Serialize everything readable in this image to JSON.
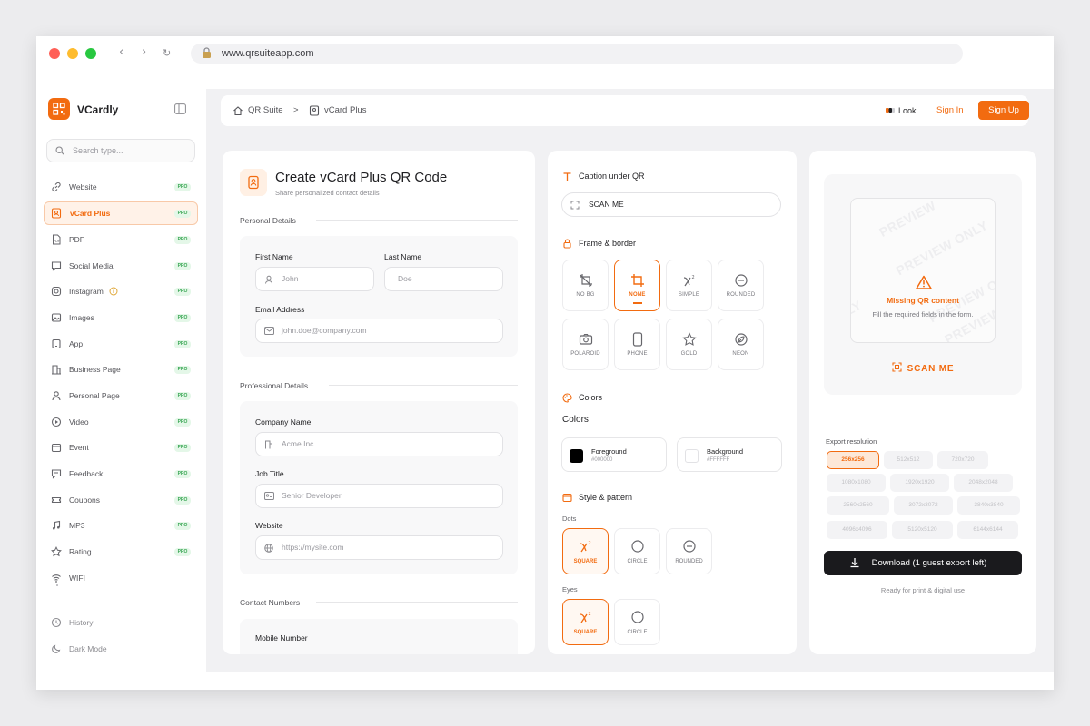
{
  "browser": {
    "url": "www.qrsuiteapp.com",
    "back": "‹",
    "forward": "›",
    "reload": "↻"
  },
  "sidebar": {
    "brand": "VCardly",
    "search_placeholder": "Search type...",
    "items": [
      {
        "label": "Website",
        "badge": "PRO",
        "icon": "link-icon"
      },
      {
        "label": "vCard Plus",
        "badge": "PRO",
        "icon": "contact-card-icon",
        "active": true
      },
      {
        "label": "PDF",
        "badge": "PRO",
        "icon": "pdf-icon"
      },
      {
        "label": "Social Media",
        "badge": "PRO",
        "icon": "chat-icon"
      },
      {
        "label": "Instagram",
        "badge": "PRO",
        "icon": "instagram-icon"
      },
      {
        "label": "Images",
        "badge": "PRO",
        "icon": "image-icon"
      },
      {
        "label": "App",
        "badge": "PRO",
        "icon": "app-icon"
      },
      {
        "label": "Business Page",
        "badge": "PRO",
        "icon": "building-icon"
      },
      {
        "label": "Personal Page",
        "badge": "PRO",
        "icon": "user-icon"
      },
      {
        "label": "Video",
        "badge": "PRO",
        "icon": "video-icon"
      },
      {
        "label": "Event",
        "badge": "PRO",
        "icon": "calendar-icon"
      },
      {
        "label": "Feedback",
        "badge": "PRO",
        "icon": "feedback-icon"
      },
      {
        "label": "Coupons",
        "badge": "PRO",
        "icon": "coupon-icon"
      },
      {
        "label": "MP3",
        "badge": "PRO",
        "icon": "music-icon"
      },
      {
        "label": "Rating",
        "badge": "PRO",
        "icon": "star-icon"
      },
      {
        "label": "WIFI",
        "icon": "wifi-icon"
      }
    ],
    "history": "History",
    "dark_mode": "Dark Mode"
  },
  "topbar": {
    "crumb_root": "QR Suite",
    "crumb_sep": ">",
    "crumb_current": "vCard Plus",
    "look": "Look",
    "sign_in": "Sign In",
    "sign_up": "Sign Up"
  },
  "form": {
    "title": "Create vCard Plus QR Code",
    "subtitle": "Share personalized contact details",
    "personal_details": "Personal Details",
    "first_name_label": "First Name",
    "first_name_placeholder": "John",
    "last_name_label": "Last Name",
    "last_name_placeholder": "Doe",
    "email_label": "Email Address",
    "email_placeholder": "john.doe@company.com",
    "professional_details": "Professional Details",
    "company_label": "Company Name",
    "company_placeholder": "Acme Inc.",
    "job_label": "Job Title",
    "job_placeholder": "Senior Developer",
    "website_label": "Website",
    "website_placeholder": "https://mysite.com",
    "contact_numbers": "Contact Numbers",
    "mobile_label": "Mobile Number"
  },
  "design": {
    "caption_header": "Caption under QR",
    "caption_value": "SCAN ME",
    "frame_header": "Frame & border",
    "frames": [
      {
        "label": "NO BG",
        "icon": "crop-off-icon"
      },
      {
        "label": "NONE",
        "icon": "crop-icon",
        "selected": true
      },
      {
        "label": "SIMPLE",
        "icon": "chi-icon"
      },
      {
        "label": "ROUNDED",
        "icon": "rounded-icon"
      },
      {
        "label": "POLAROID",
        "icon": "camera-icon"
      },
      {
        "label": "PHONE",
        "icon": "phone-icon"
      },
      {
        "label": "GOLD",
        "icon": "star-icon"
      },
      {
        "label": "NEON",
        "icon": "leaf-icon"
      }
    ],
    "colors_header": "Colors",
    "colors_subheader": "Colors",
    "foreground_label": "Foreground",
    "foreground_hex": "#000000",
    "background_label": "Background",
    "background_hex": "#FFFFFF",
    "style_header": "Style & pattern",
    "dots_label": "Dots",
    "dots": [
      {
        "label": "SQUARE",
        "icon": "chi-icon",
        "selected": true
      },
      {
        "label": "CIRCLE",
        "icon": "circle-icon"
      },
      {
        "label": "ROUNDED",
        "icon": "rounded-icon"
      }
    ],
    "eyes_label": "Eyes",
    "eyes": [
      {
        "label": "SQUARE",
        "icon": "chi-icon",
        "selected": true
      },
      {
        "label": "CIRCLE",
        "icon": "circle-icon"
      }
    ]
  },
  "preview": {
    "watermark": "PREVIEW ONLY",
    "watermark_partial": "PREVIEW",
    "watermark_edge": "LY",
    "missing_title": "Missing QR content",
    "missing_sub": "Fill the required fields in the form.",
    "caption": "SCAN ME",
    "export_label": "Export resolution",
    "resolutions": [
      "256x256",
      "512x512",
      "720x720",
      "1080x1080",
      "1920x1920",
      "2048x2048",
      "2560x2560",
      "3072x3072",
      "3840x3840",
      "4096x4096",
      "5120x5120",
      "6144x6144"
    ],
    "selected_resolution": "256x256",
    "download": "Download (1 guest export left)",
    "ready": "Ready for print & digital use"
  },
  "colors": {
    "accent": "#f26b10",
    "pro_badge": "#37a552"
  }
}
